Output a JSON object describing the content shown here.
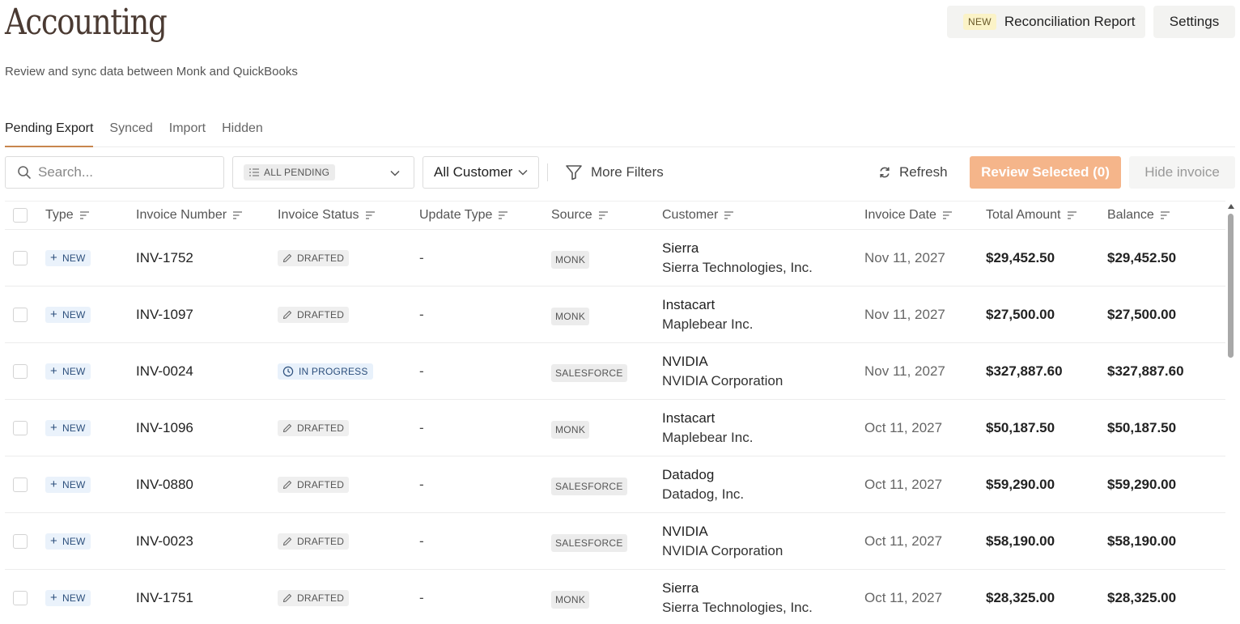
{
  "header": {
    "title": "Accounting",
    "subtitle": "Review and sync data between Monk and QuickBooks",
    "recon_new_tag": "NEW",
    "recon_label": "Reconciliation Report",
    "settings_label": "Settings"
  },
  "tabs": [
    {
      "label": "Pending Export",
      "active": true
    },
    {
      "label": "Synced",
      "active": false
    },
    {
      "label": "Import",
      "active": false
    },
    {
      "label": "Hidden",
      "active": false
    }
  ],
  "toolbar": {
    "search_placeholder": "Search...",
    "status_filter": "ALL PENDING",
    "customer_filter": "All Customer",
    "more_filters": "More Filters",
    "refresh": "Refresh",
    "review_selected": "Review Selected (0)",
    "hide_invoice": "Hide invoice"
  },
  "table": {
    "columns": [
      "Type",
      "Invoice Number",
      "Invoice Status",
      "Update Type",
      "Source",
      "Customer",
      "Invoice Date",
      "Total Amount",
      "Balance"
    ],
    "rows": [
      {
        "type": "NEW",
        "invoice": "INV-1752",
        "status": "DRAFTED",
        "update": "-",
        "source": "MONK",
        "customer": "Sierra",
        "customer_legal": "Sierra Technologies, Inc.",
        "date": "Nov 11, 2027",
        "total": "$29,452.50",
        "balance": "$29,452.50"
      },
      {
        "type": "NEW",
        "invoice": "INV-1097",
        "status": "DRAFTED",
        "update": "-",
        "source": "MONK",
        "customer": "Instacart",
        "customer_legal": "Maplebear Inc.",
        "date": "Nov 11, 2027",
        "total": "$27,500.00",
        "balance": "$27,500.00"
      },
      {
        "type": "NEW",
        "invoice": "INV-0024",
        "status": "IN PROGRESS",
        "update": "-",
        "source": "SALESFORCE",
        "customer": "NVIDIA",
        "customer_legal": "NVIDIA Corporation",
        "date": "Nov 11, 2027",
        "total": "$327,887.60",
        "balance": "$327,887.60"
      },
      {
        "type": "NEW",
        "invoice": "INV-1096",
        "status": "DRAFTED",
        "update": "-",
        "source": "MONK",
        "customer": "Instacart",
        "customer_legal": "Maplebear Inc.",
        "date": "Oct 11, 2027",
        "total": "$50,187.50",
        "balance": "$50,187.50"
      },
      {
        "type": "NEW",
        "invoice": "INV-0880",
        "status": "DRAFTED",
        "update": "-",
        "source": "SALESFORCE",
        "customer": "Datadog",
        "customer_legal": "Datadog, Inc.",
        "date": "Oct 11, 2027",
        "total": "$59,290.00",
        "balance": "$59,290.00"
      },
      {
        "type": "NEW",
        "invoice": "INV-0023",
        "status": "DRAFTED",
        "update": "-",
        "source": "SALESFORCE",
        "customer": "NVIDIA",
        "customer_legal": "NVIDIA Corporation",
        "date": "Oct 11, 2027",
        "total": "$58,190.00",
        "balance": "$58,190.00"
      },
      {
        "type": "NEW",
        "invoice": "INV-1751",
        "status": "DRAFTED",
        "update": "-",
        "source": "MONK",
        "customer": "Sierra",
        "customer_legal": "Sierra Technologies, Inc.",
        "date": "Oct 11, 2027",
        "total": "$28,325.00",
        "balance": "$28,325.00"
      }
    ]
  },
  "icons": {
    "search": "search-icon",
    "status_list": "list-icon",
    "chevron": "chevron-down-icon",
    "filter": "funnel-icon",
    "refresh": "refresh-icon",
    "sort": "sort-icon",
    "drafted": "pencil-icon",
    "in_progress": "clock-icon"
  },
  "colors": {
    "accent": "#c8864e",
    "review_button": "#f5b58a",
    "type_badge_bg": "#eaf2fb",
    "new_tag_bg": "#fbf3c7"
  }
}
